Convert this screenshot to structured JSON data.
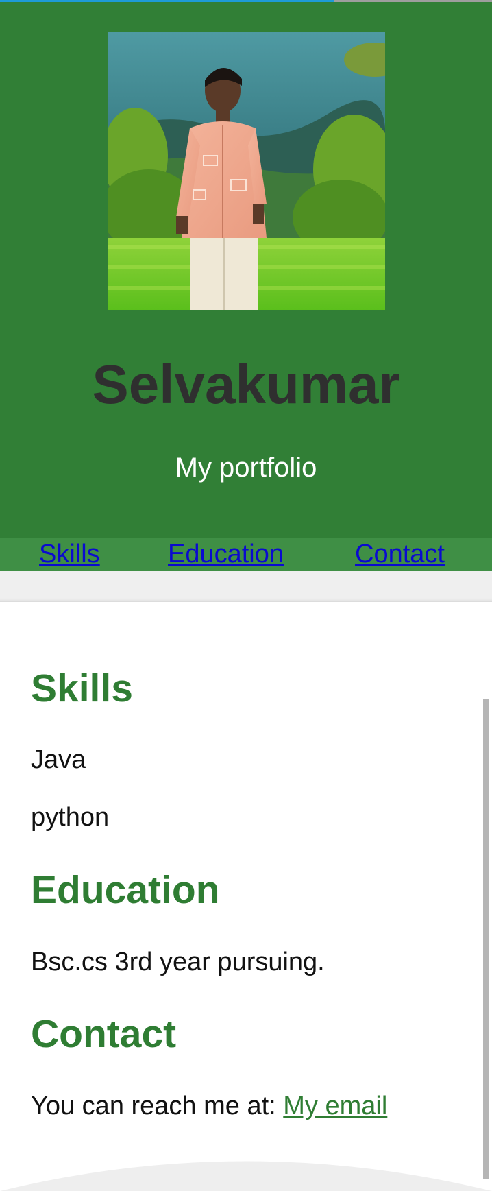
{
  "browser": {
    "load_progress": 0.68
  },
  "header": {
    "name": "Selvakumar",
    "tagline": "My portfolio",
    "photo_alt": "Profile photo"
  },
  "nav": {
    "items": [
      {
        "label": "Skills"
      },
      {
        "label": "Education"
      },
      {
        "label": "Contact"
      }
    ]
  },
  "sections": {
    "skills": {
      "title": "Skills",
      "items": [
        "Java",
        "python"
      ]
    },
    "education": {
      "title": "Education",
      "text": "Bsc.cs 3rd year pursuing."
    },
    "contact": {
      "title": "Contact",
      "text": "You can reach me at: ",
      "link_label": "My email"
    }
  },
  "colors": {
    "header_bg": "#317f36",
    "nav_bg": "#3f8f45",
    "heading_green": "#2f7d33",
    "link_blue": "#0a0ad0"
  }
}
